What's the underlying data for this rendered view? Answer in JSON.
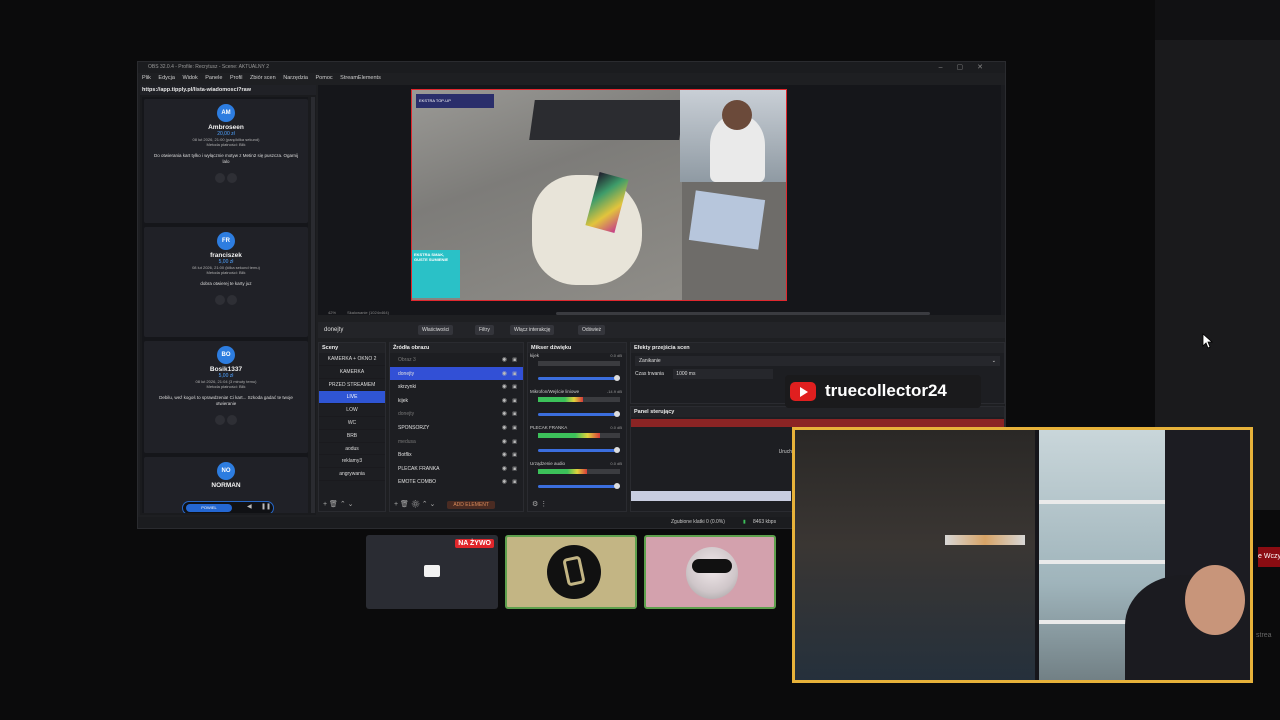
{
  "window": {
    "title": "OBS 32.0.4 - Profile: Recrytusz - Scene: AKTUALNY 2",
    "menu": [
      "Plik",
      "Edycja",
      "Widok",
      "Panele",
      "Profil",
      "Zbiór scen",
      "Narzędzia",
      "Pomoc",
      "StreamElements"
    ]
  },
  "dock": {
    "url": "https://app.tipply.pl/lista-wiadomosci?raw",
    "donations": [
      {
        "initials": "AM",
        "name": "Ambroseen",
        "amount": "20,00 zł",
        "date": "08 lut 2026, 21:00 (parę/kilka sekund)",
        "method": "Metoda płatności: Blik",
        "message": "Do otwierania kart tylko i wyłącznie motyw z Metin2 się puszcza. Ogarnij lalo"
      },
      {
        "initials": "FR",
        "name": "franciszek",
        "amount": "5,00 zł",
        "date": "08 lut 2026, 21:00 (kilka sekund temu)",
        "method": "Metoda płatności: Blik",
        "message": "dobra otwierej te karty juz"
      },
      {
        "initials": "BO",
        "name": "Bosik1337",
        "amount": "5,00 zł",
        "date": "08 lut 2026, 21:04 (3 minuty temu)",
        "method": "Metoda płatności: Blik",
        "message": "Debilu, weź kogoś to sprawdzenia! Ci kart... Szkoda gadać te twoje otwieranie"
      },
      {
        "initials": "NO",
        "name": "NORMAN",
        "amount": "",
        "date": "",
        "method": "",
        "message": ""
      }
    ],
    "player_label": "POWIEL"
  },
  "preview": {
    "zoom": "42%",
    "scale_label": "Skalowanie (1024x464)",
    "overlay_badge": "EKSTRA TOP-UP",
    "promo_text": "EKSTRA SMAK, GUSTE SUMIENIE"
  },
  "source_toolbar": {
    "current_source": "donejty",
    "buttons": [
      "Właściwości",
      "Filtry",
      "Włącz interakcję",
      "Odśwież"
    ]
  },
  "scenes": {
    "title": "Sceny",
    "items": [
      "KAMERKA + OKNO 2",
      "KAMERKA",
      "PRZED STREAMEM",
      "LIVE",
      "LOW",
      "WC",
      "BRB",
      "aodus",
      "reklamy3",
      "angrywania"
    ],
    "active_index": 3
  },
  "sources": {
    "title": "Źródła obrazu",
    "items": [
      {
        "name": "Obraz 3",
        "state": "dim"
      },
      {
        "name": "donejty",
        "state": "active"
      },
      {
        "name": "skrzynki",
        "state": "normal"
      },
      {
        "name": "kijek",
        "state": "normal"
      },
      {
        "name": "donejty",
        "state": "dim"
      },
      {
        "name": "SPONSORZY",
        "state": "normal"
      },
      {
        "name": "medusa",
        "state": "dim"
      },
      {
        "name": "Botflix",
        "state": "normal"
      },
      {
        "name": "PLECAK FRANKA",
        "state": "normal"
      },
      {
        "name": "EMOTE COMBO",
        "state": "normal"
      }
    ],
    "add_label": "ADD ELEMENT"
  },
  "mixer": {
    "title": "Mikser dźwięku",
    "channels": [
      {
        "name": "kijek",
        "db": "0.0 dB",
        "level": 0.0
      },
      {
        "name": "Mikrofon/Wejście liniowe",
        "db": "-14.9 dB",
        "level": 0.55
      },
      {
        "name": "PLECAK FRANKA",
        "db": "0.0 dB",
        "level": 0.75
      },
      {
        "name": "Urządzenie audio",
        "db": "0.0 dB",
        "level": 0.6
      }
    ]
  },
  "transitions": {
    "title": "Efekty przejścia scen",
    "selected": "Zanikanie",
    "duration_label": "Czas trwania",
    "duration_value": "1000 ms"
  },
  "controls": {
    "title": "Panel sterujący",
    "side_label": "Uruch"
  },
  "status": {
    "dropped": "Zgubione klatki 0 (0.0%)",
    "bitrate": "8463 kbps"
  },
  "thumbnails": {
    "live_label": "NA ŻYWO"
  },
  "youtube": {
    "channel": "truecollector24"
  },
  "edge_text": "e Wczy",
  "edge_text2": "strea"
}
